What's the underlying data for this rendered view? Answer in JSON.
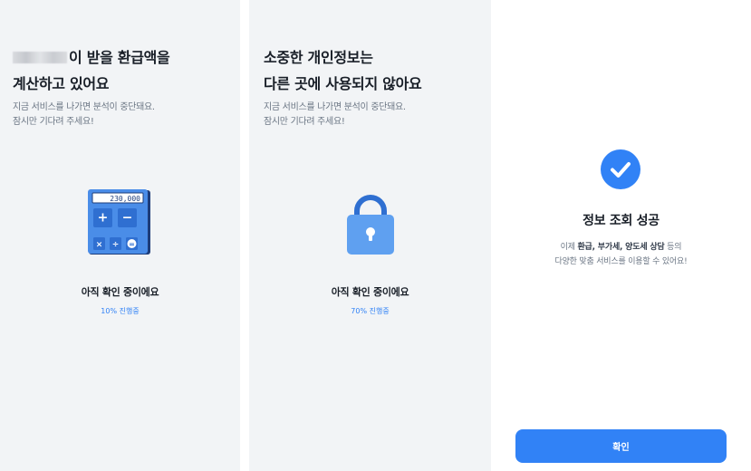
{
  "panels": [
    {
      "title_line1_suffix": "이 받을 환급액을",
      "title_line2": "계산하고 있어요",
      "subtitle_line1": "지금 서비스를 나가면 분석이 중단돼요.",
      "subtitle_line2": "잠시만 기다려 주세요!",
      "calculator_display": "230,000",
      "calculator_keys": [
        "+",
        "−",
        "×",
        "÷",
        "="
      ],
      "illustration_icon": "calculator-icon",
      "status": "아직 확인 중이에요",
      "progress_text": "10% 진행중",
      "progress_value": 10
    },
    {
      "title_line1": "소중한 개인정보는",
      "title_line2": "다른 곳에 사용되지 않아요",
      "subtitle_line1": "지금 서비스를 나가면 분석이 중단돼요.",
      "subtitle_line2": "잠시만 기다려 주세요!",
      "illustration_icon": "lock-icon",
      "status": "아직 확인 중이에요",
      "progress_text": "70% 진행중",
      "progress_value": 70
    },
    {
      "success_icon": "check-circle-icon",
      "title": "정보 조회 성공",
      "desc_line1_prefix": "이제 ",
      "desc_highlight": "환급, 부가세, 양도세 상담",
      "desc_line1_suffix": " 등의",
      "desc_line2": "다양한 맞춤 서비스를 이용할 수 있어요!",
      "confirm_label": "확인"
    }
  ],
  "colors": {
    "accent": "#3182f6",
    "panel_bg": "#f2f4f6",
    "text_primary": "#191f28",
    "text_secondary": "#6b7684",
    "calculator_body": "#4a8de8",
    "calculator_frame": "#1e3d7a",
    "lock_body": "#5fa0f0"
  }
}
